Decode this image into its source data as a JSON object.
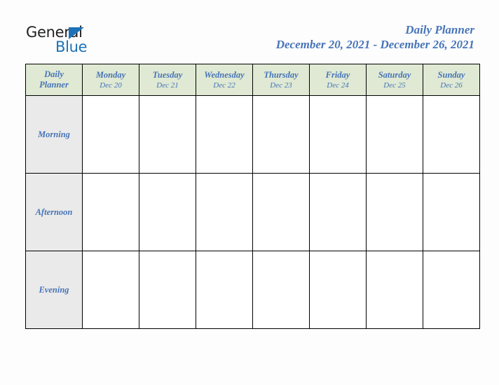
{
  "brand": {
    "name_dark": "General",
    "name_blue": "Blue",
    "triangle_color": "#1b72b8",
    "dark_color": "#231f20"
  },
  "header": {
    "title": "Daily Planner",
    "date_range": "December 20, 2021 - December 26, 2021",
    "title_color": "#4774b8"
  },
  "table": {
    "corner_line1": "Daily",
    "corner_line2": "Planner",
    "header_bg": "#dfe9d3",
    "label_bg": "#eaeaea",
    "border_color": "#000000",
    "days": [
      {
        "name": "Monday",
        "date": "Dec 20"
      },
      {
        "name": "Tuesday",
        "date": "Dec 21"
      },
      {
        "name": "Wednesday",
        "date": "Dec 22"
      },
      {
        "name": "Thursday",
        "date": "Dec 23"
      },
      {
        "name": "Friday",
        "date": "Dec 24"
      },
      {
        "name": "Saturday",
        "date": "Dec 25"
      },
      {
        "name": "Sunday",
        "date": "Dec 26"
      }
    ],
    "slots": [
      {
        "label": "Morning",
        "entries": [
          "",
          "",
          "",
          "",
          "",
          "",
          ""
        ]
      },
      {
        "label": "Afternoon",
        "entries": [
          "",
          "",
          "",
          "",
          "",
          "",
          ""
        ]
      },
      {
        "label": "Evening",
        "entries": [
          "",
          "",
          "",
          "",
          "",
          "",
          ""
        ]
      }
    ]
  }
}
